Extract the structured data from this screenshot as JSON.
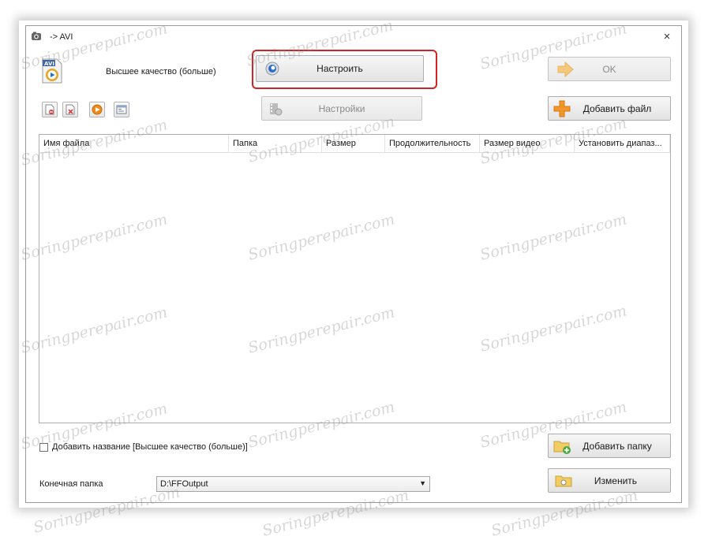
{
  "window": {
    "title": "-> AVI",
    "close_label": "×"
  },
  "quality": {
    "label": "Высшее качество (больше)"
  },
  "buttons": {
    "configure": "Настроить",
    "settings": "Настройки",
    "ok": "OK",
    "add_file": "Добавить файл",
    "add_folder": "Добавить папку",
    "change": "Изменить"
  },
  "table": {
    "columns": [
      "Имя файла",
      "Папка",
      "Размер",
      "Продолжительность",
      "Размер видео",
      "Установить диапаз..."
    ]
  },
  "options": {
    "add_name_label": "Добавить название [Высшее качество (больше)]",
    "add_name_checked": false
  },
  "destination": {
    "label": "Конечная папка",
    "value": "D:\\FFOutput"
  },
  "watermark": "Soringperepair.com",
  "colors": {
    "highlight": "#d52222",
    "ok_arrow": "#f5c97c",
    "add_plus": "#f0962a"
  }
}
